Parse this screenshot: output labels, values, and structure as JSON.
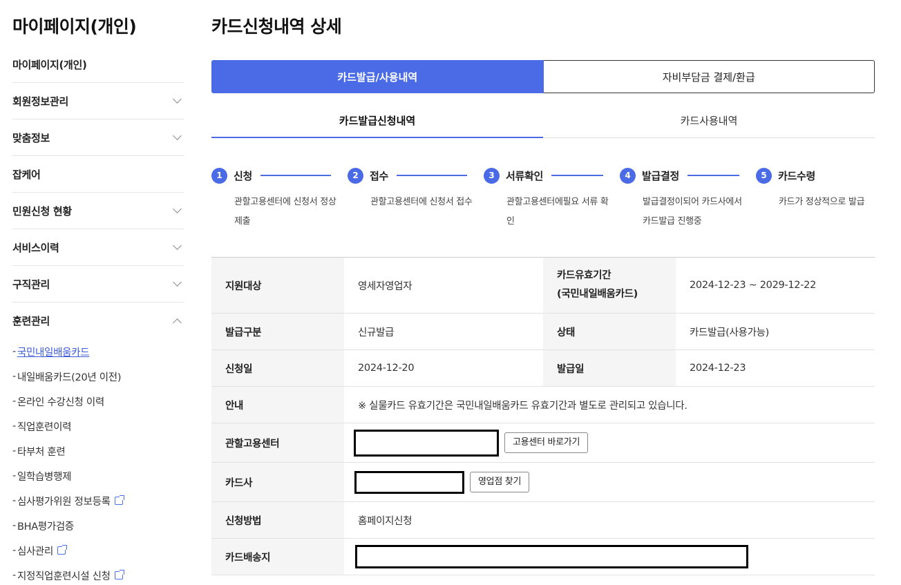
{
  "sidebar": {
    "title": "마이페이지(개인)",
    "items": [
      {
        "label": "마이페이지(개인)"
      },
      {
        "label": "회원정보관리"
      },
      {
        "label": "맞춤정보"
      },
      {
        "label": "잡케어"
      },
      {
        "label": "민원신청 현황"
      },
      {
        "label": "서비스이력"
      },
      {
        "label": "구직관리"
      },
      {
        "label": "훈련관리"
      }
    ],
    "sub_items": [
      {
        "label": "국민내일배움카드"
      },
      {
        "label": "내일배움카드(20년 이전)"
      },
      {
        "label": "온라인 수강신청 이력"
      },
      {
        "label": "직업훈련이력"
      },
      {
        "label": "타부처 훈련"
      },
      {
        "label": "일학습병행제"
      },
      {
        "label": "심사평가위원 정보등록"
      },
      {
        "label": "BHA평가검증"
      },
      {
        "label": "심사관리"
      },
      {
        "label": "지정직업훈련시설 신청"
      }
    ],
    "dash": "-"
  },
  "main": {
    "title": "카드신청내역 상세",
    "tabs": [
      {
        "label": "카드발급/사용내역"
      },
      {
        "label": "자비부담금 결제/환급"
      }
    ],
    "subtabs": [
      {
        "label": "카드발급신청내역"
      },
      {
        "label": "카드사용내역"
      }
    ],
    "steps": [
      {
        "num": "1",
        "name": "신청",
        "desc": "관할고용센터에 신청서 정상제출"
      },
      {
        "num": "2",
        "name": "접수",
        "desc": "관할고용센터에 신청서 접수"
      },
      {
        "num": "3",
        "name": "서류확인",
        "desc": "관할고용센터에필요 서류 확인"
      },
      {
        "num": "4",
        "name": "발급결정",
        "desc": "발급결정이되어 카드사에서 카드발급 진행중"
      },
      {
        "num": "5",
        "name": "카드수령",
        "desc": "카드가 정상적으로 발급"
      }
    ],
    "info": {
      "target_label": "지원대상",
      "target_value": "영세자영업자",
      "validity_label_1": "카드유효기간",
      "validity_label_2": "(국민내일배움카드)",
      "validity_value": "2024-12-23 ~ 2029-12-22",
      "issue_type_label": "발급구분",
      "issue_type_value": "신규발급",
      "status_label": "상태",
      "status_value": "카드발급(사용가능)",
      "apply_date_label": "신청일",
      "apply_date_value": "2024-12-20",
      "issue_date_label": "발급일",
      "issue_date_value": "2024-12-23",
      "notice_label": "안내",
      "notice_value": "※ 실물카드 유효기간은 국민내일배움카드 유효기간과 별도로 관리되고 있습니다.",
      "center_label": "관할고용센터",
      "center_button": "고용센터 바로가기",
      "card_company_label": "카드사",
      "card_company_button": "영업점 찾기",
      "method_label": "신청방법",
      "method_value": "홈페이지신청",
      "address_label": "카드배송지"
    }
  },
  "colors": {
    "accent": "#4a6ae6",
    "link": "#3b5bdb",
    "table_header_bg": "#f5f5f5"
  }
}
